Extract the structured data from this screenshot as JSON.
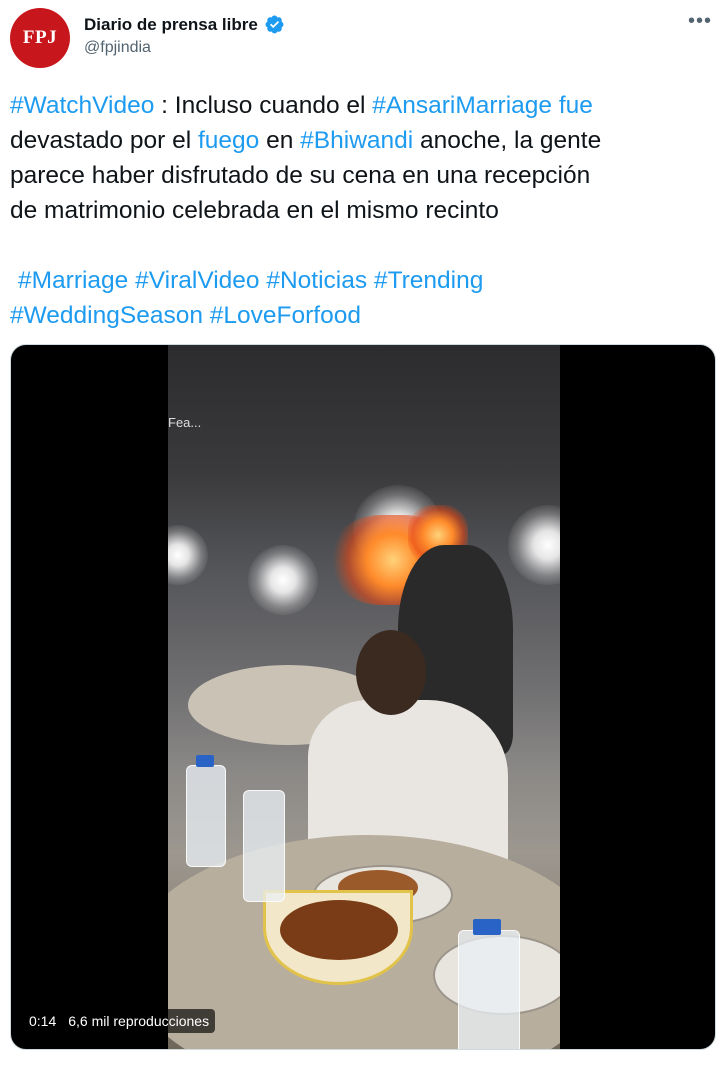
{
  "author": {
    "avatar_text": "FPJ",
    "display_name": "Diario de prensa libre",
    "handle": "@fpjindia",
    "verified": true,
    "avatar_color": "#c8161d"
  },
  "more_icon": "more-horizontal-icon",
  "tweet": {
    "line1": [
      {
        "text": "#WatchVideo",
        "tag": true
      },
      {
        "text": " : Incluso cuando el ",
        "tag": false
      },
      {
        "text": "#AnsariMarriage",
        "tag": true
      },
      {
        "text": " ",
        "tag": false
      },
      {
        "text": "fue",
        "tag": true
      }
    ],
    "line2": [
      {
        "text": "devastado por el ",
        "tag": false
      },
      {
        "text": "fuego",
        "tag": true
      },
      {
        "text": " en ",
        "tag": false
      },
      {
        "text": "#Bhiwandi",
        "tag": true
      },
      {
        "text": " anoche, la gente",
        "tag": false
      }
    ],
    "line3": "parece haber disfrutado de su cena en una recepción",
    "line4": "de matrimonio celebrada en el mismo recinto",
    "hashtags_line1": [
      "#Marriage",
      "#ViralVideo",
      "#Noticias",
      "#Trending"
    ],
    "hashtags_line2": [
      "#WeddingSeason",
      "#LoveForfood"
    ],
    "link_color": "#1d9bf0"
  },
  "video": {
    "watermark": "Fea...",
    "duration": "0:14",
    "views": "6,6 mil reproducciones"
  }
}
